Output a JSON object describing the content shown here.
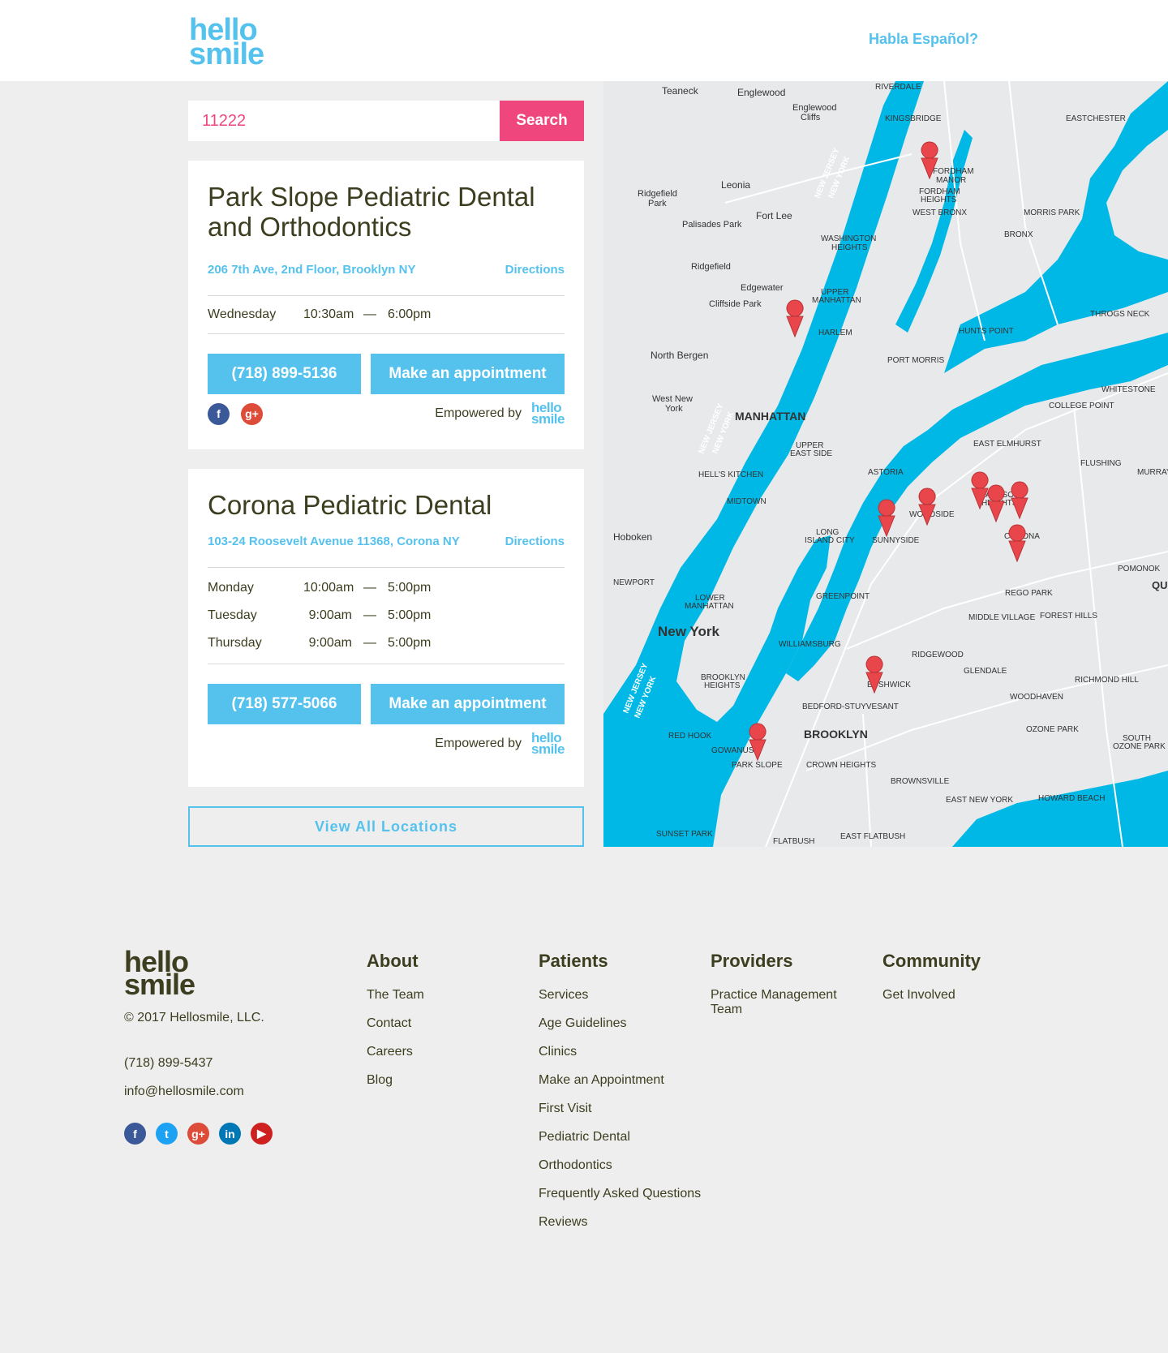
{
  "header": {
    "logo_line1": "hello",
    "logo_line2": "smile",
    "habla": "Habla Español?"
  },
  "search": {
    "value": "11222",
    "button": "Search"
  },
  "clinics": [
    {
      "name": "Park Slope Pediatric Dental and Orthodontics",
      "address": "206 7th Ave, 2nd Floor, Brooklyn NY",
      "directions": "Directions",
      "hours": [
        {
          "day": "Wednesday",
          "open": "10:30am",
          "dash": "—",
          "close": "6:00pm"
        }
      ],
      "phone": "(718) 899-5136",
      "appointment": "Make an appointment",
      "empowered": "Empowered by",
      "mini_logo_1": "hello",
      "mini_logo_2": "smile"
    },
    {
      "name": "Corona Pediatric Dental",
      "address": "103-24 Roosevelt Avenue 11368, Corona NY",
      "directions": "Directions",
      "hours": [
        {
          "day": "Monday",
          "open": "10:00am",
          "dash": "—",
          "close": "5:00pm"
        },
        {
          "day": "Tuesday",
          "open": "9:00am",
          "dash": "—",
          "close": "5:00pm"
        },
        {
          "day": "Thursday",
          "open": "9:00am",
          "dash": "—",
          "close": "5:00pm"
        }
      ],
      "phone": "(718) 577-5066",
      "appointment": "Make an appointment",
      "empowered": "Empowered by",
      "mini_logo_1": "hello",
      "mini_logo_2": "smile"
    }
  ],
  "view_all": "View All Locations",
  "map": {
    "water_color": "#00b8e6",
    "land_color": "#e7e9ea",
    "marker_color": "#e8464b",
    "labels": [
      "Teaneck",
      "Englewood",
      "Englewood Cliffs",
      "RIVERDALE",
      "KINGSBRIDGE",
      "EASTCHESTER",
      "Leonia",
      "Ridgefield Park",
      "Fort Lee",
      "Palisades Park",
      "FORDHAM MANOR",
      "FORDHAM HEIGHTS",
      "WEST BRONX",
      "MORRIS PARK",
      "BRONX",
      "WASHINGTON HEIGHTS",
      "Ridgefield",
      "Edgewater",
      "Cliffside Park",
      "UPPER MANHATTAN",
      "HARLEM",
      "THROGS NECK",
      "HUNTS POINT",
      "North Bergen",
      "PORT MORRIS",
      "WHITESTONE",
      "West New York",
      "MANHATTAN",
      "COLLEGE POINT",
      "UPPER EAST SIDE",
      "EAST ELMHURST",
      "FLUSHING",
      "ASTORIA",
      "HELL'S KITCHEN",
      "JACKSON HEIGHTS",
      "MIDTOWN",
      "Hoboken",
      "WOODSIDE",
      "SUNNYSIDE",
      "LONG ISLAND CITY",
      "CORONA",
      "POMONOK",
      "NEWPORT",
      "GREENPOINT",
      "REGO PARK",
      "LOWER MANHATTAN",
      "MIDDLE VILLAGE",
      "FOREST HILLS",
      "New York",
      "WILLIAMSBURG",
      "RIDGEWOOD",
      "GLENDALE",
      "BROOKLYN HEIGHTS",
      "BUSHWICK",
      "RICHMOND HILL",
      "BEDFORD-STUYVESANT",
      "WOODHAVEN",
      "RED HOOK",
      "BROOKLYN",
      "OZONE PARK",
      "GOWANUS",
      "PARK SLOPE",
      "CROWN HEIGHTS",
      "SOUTH OZONE PARK",
      "BROWNSVILLE",
      "EAST NEW YORK",
      "HOWARD BEACH",
      "SUNSET PARK",
      "FLATBUSH",
      "EAST FLATBUSH",
      "NEW JERSEY",
      "NEW YORK",
      "Edge Water",
      "QU",
      "MURRAY H"
    ]
  },
  "footer": {
    "logo_line1": "hello",
    "logo_line2": "smile",
    "copyright": "© 2017 Hellosmile, LLC.",
    "phone": "(718) 899-5437",
    "email": "info@hellosmile.com",
    "columns": [
      {
        "title": "About",
        "links": [
          "The Team",
          "Contact",
          "Careers",
          "Blog"
        ]
      },
      {
        "title": "Patients",
        "links": [
          "Services",
          "Age Guidelines",
          "Clinics",
          "Make an Appointment",
          "First Visit",
          "Pediatric Dental",
          "Orthodontics",
          "Frequently Asked Questions",
          "Reviews"
        ]
      },
      {
        "title": "Providers",
        "links": [
          "Practice Management Team"
        ]
      },
      {
        "title": "Community",
        "links": [
          "Get Involved"
        ]
      }
    ],
    "social": [
      "f",
      "t",
      "g+",
      "in",
      "▶"
    ]
  },
  "social_glyphs": {
    "facebook": "f",
    "googleplus": "g+"
  }
}
